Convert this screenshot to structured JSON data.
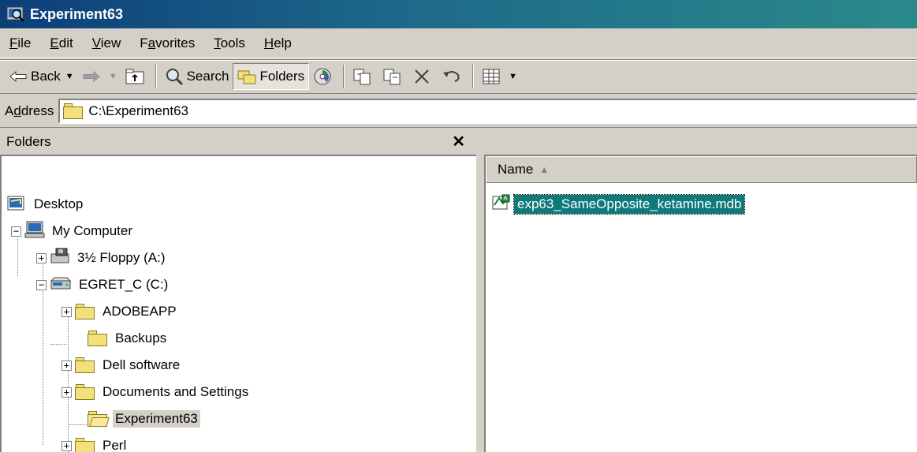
{
  "window": {
    "title": "Experiment63"
  },
  "menu": [
    {
      "mnemonic": "F",
      "rest": "ile"
    },
    {
      "mnemonic": "E",
      "rest": "dit"
    },
    {
      "mnemonic": "V",
      "rest": "iew"
    },
    {
      "prefix": "F",
      "mnemonic": "a",
      "rest": "vorites"
    },
    {
      "mnemonic": "T",
      "rest": "ools"
    },
    {
      "mnemonic": "H",
      "rest": "elp"
    }
  ],
  "toolbar": {
    "back_label": "Back",
    "search_label": "Search",
    "folders_label": "Folders"
  },
  "address": {
    "label_prefix": "A",
    "label_mnemonic": "d",
    "label_rest": "dress",
    "value": "C:\\Experiment63"
  },
  "folders_pane": {
    "title": "Folders",
    "close_glyph": "✕",
    "tree": [
      {
        "label": "Desktop",
        "icon": "desktop-icon",
        "level": 0,
        "expander": ""
      },
      {
        "label": "My Computer",
        "icon": "computer-icon",
        "level": 1,
        "expander": "−"
      },
      {
        "label": "3½ Floppy (A:)",
        "icon": "floppy-icon",
        "level": 2,
        "expander": "+"
      },
      {
        "label": "EGRET_C (C:)",
        "icon": "drive-icon",
        "level": 2,
        "expander": "−"
      },
      {
        "label": "ADOBEAPP",
        "icon": "folder-icon",
        "level": 3,
        "expander": "+"
      },
      {
        "label": "Backups",
        "icon": "folder-icon",
        "level": 3,
        "expander": ""
      },
      {
        "label": "Dell software",
        "icon": "folder-icon",
        "level": 3,
        "expander": "+"
      },
      {
        "label": "Documents and Settings",
        "icon": "folder-icon",
        "level": 3,
        "expander": "+"
      },
      {
        "label": "Experiment63",
        "icon": "open-folder-icon",
        "level": 3,
        "expander": "",
        "selected": true
      },
      {
        "label": "Perl",
        "icon": "folder-icon",
        "level": 3,
        "expander": "+"
      }
    ]
  },
  "content_pane": {
    "column_name": "Name",
    "sort_glyph": "▲",
    "files": [
      {
        "name": "exp63_SameOpposite_ketamine.mdb",
        "icon": "access-db-icon",
        "selected": true
      }
    ]
  },
  "colors": {
    "titlebar_start": "#0c3e7a",
    "titlebar_end": "#2a8a8a",
    "selection": "#0f7a7a",
    "face": "#d4d0c8"
  }
}
